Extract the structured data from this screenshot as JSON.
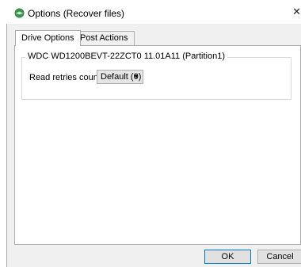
{
  "window": {
    "title": "Options (Recover files)",
    "app_icon": "green-disk-icon",
    "close_icon": "close-icon",
    "close_glyph": "✕"
  },
  "tabs": [
    {
      "label": "Drive Options",
      "selected": true
    },
    {
      "label": "Post Actions",
      "selected": false
    }
  ],
  "drive_options": {
    "group_title": "WDC WD1200BEVT-22ZCT0 11.01A11 (Partition1)",
    "read_retries": {
      "label": "Read retries count:",
      "value": "Default (0)",
      "arrow_glyph": "▼"
    }
  },
  "buttons": {
    "ok": "OK",
    "cancel": "Cancel"
  },
  "colors": {
    "focus_border": "#0078d7",
    "dialog_face": "#f0f0f0"
  }
}
